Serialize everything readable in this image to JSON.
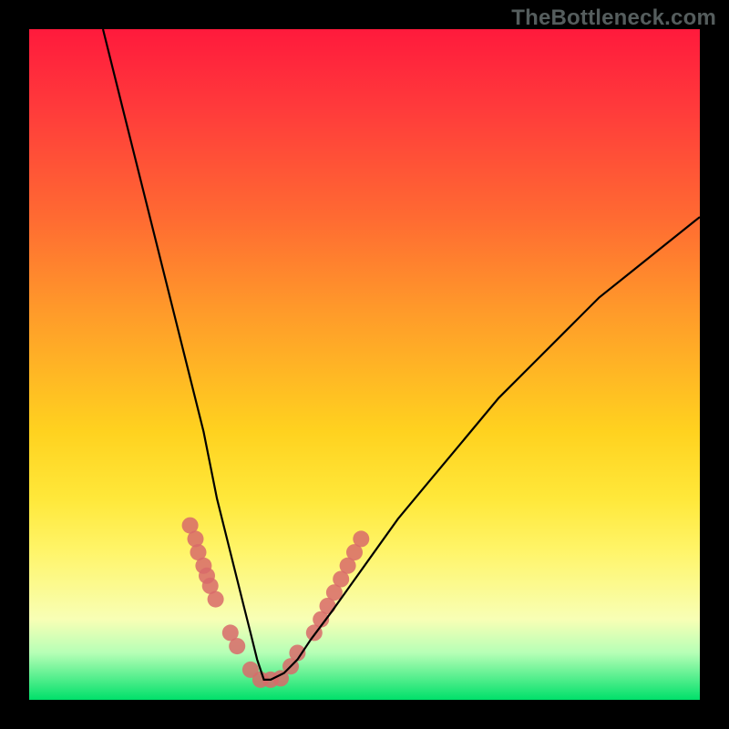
{
  "watermark": "TheBottleneck.com",
  "chart_data": {
    "type": "line",
    "title": "",
    "xlabel": "",
    "ylabel": "",
    "xlim": [
      0,
      100
    ],
    "ylim": [
      0,
      100
    ],
    "grid": false,
    "legend": false,
    "series": [
      {
        "name": "bottleneck-curve",
        "color": "#000000",
        "x": [
          11,
          14,
          17,
          20,
          23,
          26,
          28,
          30,
          32,
          33,
          34,
          35,
          36,
          38,
          40,
          42,
          45,
          50,
          55,
          60,
          65,
          70,
          75,
          80,
          85,
          90,
          95,
          100
        ],
        "y": [
          100,
          88,
          76,
          64,
          52,
          40,
          30,
          22,
          14,
          10,
          6,
          3,
          3,
          4,
          6,
          9,
          13,
          20,
          27,
          33,
          39,
          45,
          50,
          55,
          60,
          64,
          68,
          72
        ]
      }
    ],
    "markers": {
      "name": "highlight-dots",
      "color": "#d86a6a",
      "radius": 9,
      "points": [
        {
          "x": 24.0,
          "y": 26.0
        },
        {
          "x": 24.8,
          "y": 24.0
        },
        {
          "x": 25.2,
          "y": 22.0
        },
        {
          "x": 26.0,
          "y": 20.0
        },
        {
          "x": 26.5,
          "y": 18.5
        },
        {
          "x": 27.0,
          "y": 17.0
        },
        {
          "x": 27.8,
          "y": 15.0
        },
        {
          "x": 30.0,
          "y": 10.0
        },
        {
          "x": 31.0,
          "y": 8.0
        },
        {
          "x": 33.0,
          "y": 4.5
        },
        {
          "x": 34.5,
          "y": 3.0
        },
        {
          "x": 36.0,
          "y": 3.0
        },
        {
          "x": 37.5,
          "y": 3.2
        },
        {
          "x": 39.0,
          "y": 5.0
        },
        {
          "x": 40.0,
          "y": 7.0
        },
        {
          "x": 42.5,
          "y": 10.0
        },
        {
          "x": 43.5,
          "y": 12.0
        },
        {
          "x": 44.5,
          "y": 14.0
        },
        {
          "x": 45.5,
          "y": 16.0
        },
        {
          "x": 46.5,
          "y": 18.0
        },
        {
          "x": 47.5,
          "y": 20.0
        },
        {
          "x": 48.5,
          "y": 22.0
        },
        {
          "x": 49.5,
          "y": 24.0
        }
      ]
    },
    "background_gradient": {
      "top": "#ff1a3c",
      "mid": "#ffd21f",
      "bottom": "#00e06a"
    }
  }
}
